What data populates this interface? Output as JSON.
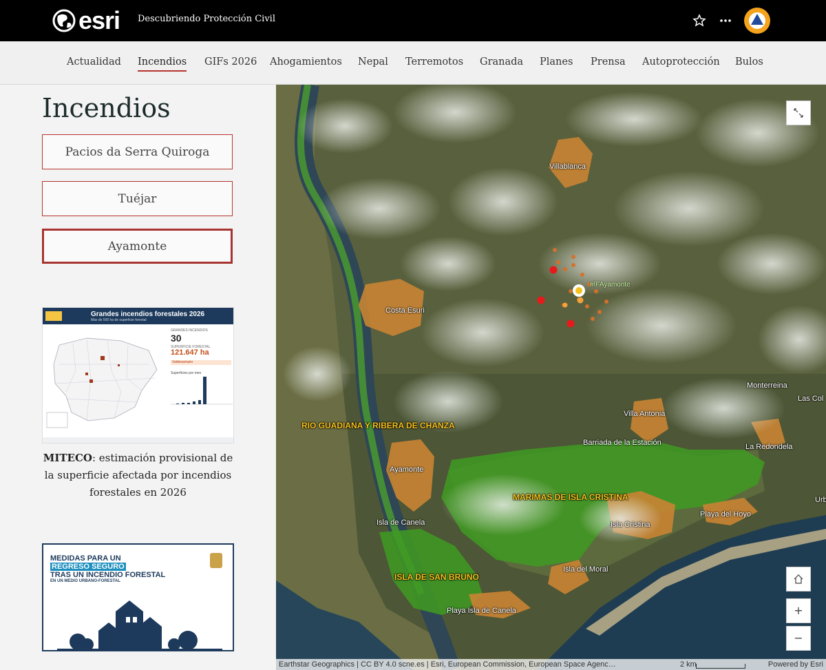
{
  "header": {
    "brand": "esri",
    "site_title": "Descubriendo Protección Civil",
    "icons": [
      "globe-logo-icon",
      "star-icon",
      "more-icon",
      "civil-protection-avatar"
    ]
  },
  "nav": {
    "items": [
      {
        "label": "Actualidad",
        "active": false
      },
      {
        "label": "Incendios",
        "active": true
      },
      {
        "label": "GIFs 2026",
        "active": false
      },
      {
        "label": "Ahogamientos",
        "active": false
      },
      {
        "label": "Nepal",
        "active": false
      },
      {
        "label": "Terremotos",
        "active": false
      },
      {
        "label": "Granada",
        "active": false
      },
      {
        "label": "Planes",
        "active": false
      },
      {
        "label": "Prensa",
        "active": false
      },
      {
        "label": "Autoprotección",
        "active": false
      },
      {
        "label": "Bulos",
        "active": false
      }
    ]
  },
  "sidebar": {
    "title": "Incendios",
    "buttons": [
      {
        "label": "Pacios da Serra Quiroga",
        "selected": false
      },
      {
        "label": "Tuéjar",
        "selected": false
      },
      {
        "label": "Ayamonte",
        "selected": true
      }
    ],
    "infographic": {
      "title": "Grandes incendios forestales 2026",
      "subtitle": "Más de 500 ha de superficie forestal",
      "count_label": "GRANDES INCENDIOS",
      "count": "30",
      "area_label": "SUPERFICIE FORESTAL",
      "area": "121.647 ha",
      "tag": "Valdesamario",
      "chart_label": "Superficies por mes"
    },
    "caption_bold": "MITECO",
    "caption_rest": ": estimación provisional de la superficie afectada por incendios forestales en 2026",
    "poster": {
      "line1": "MEDIDAS PARA UN",
      "line2": "REGRESO SEGURO",
      "line3": "TRAS UN INCENDIO FORESTAL",
      "line4": "EN UN MEDIO URBANO-FORESTAL"
    }
  },
  "map": {
    "places": [
      "Villablanca",
      "Costa Esuri",
      "Villa Antonia",
      "Barriada de la Estación",
      "Monterreina",
      "Las Col",
      "La Redondela",
      "Ayamonte",
      "Isla de Canela",
      "Isla Cristina",
      "Playa del Hoyo",
      "Isla del Moral",
      "Playa Isla de Canela",
      "Urb"
    ],
    "protected_areas": [
      "RIO GUADIANA Y RIBERA DE CHANZA",
      "MARIMAS DE ISLA CRISTINA",
      "ISLA DE SAN BRUNO"
    ],
    "fire_label": "#IFAyamonte",
    "controls": {
      "expand": "expand-icon",
      "home": "home-icon",
      "zoom_in": "+",
      "zoom_out": "−"
    },
    "attribution": "Earthstar Geographics | CC BY 4.0 scne.es | Esri, European Commission, European Space Agenc…",
    "scale": "2 km",
    "powered_by": "Powered by Esri"
  }
}
